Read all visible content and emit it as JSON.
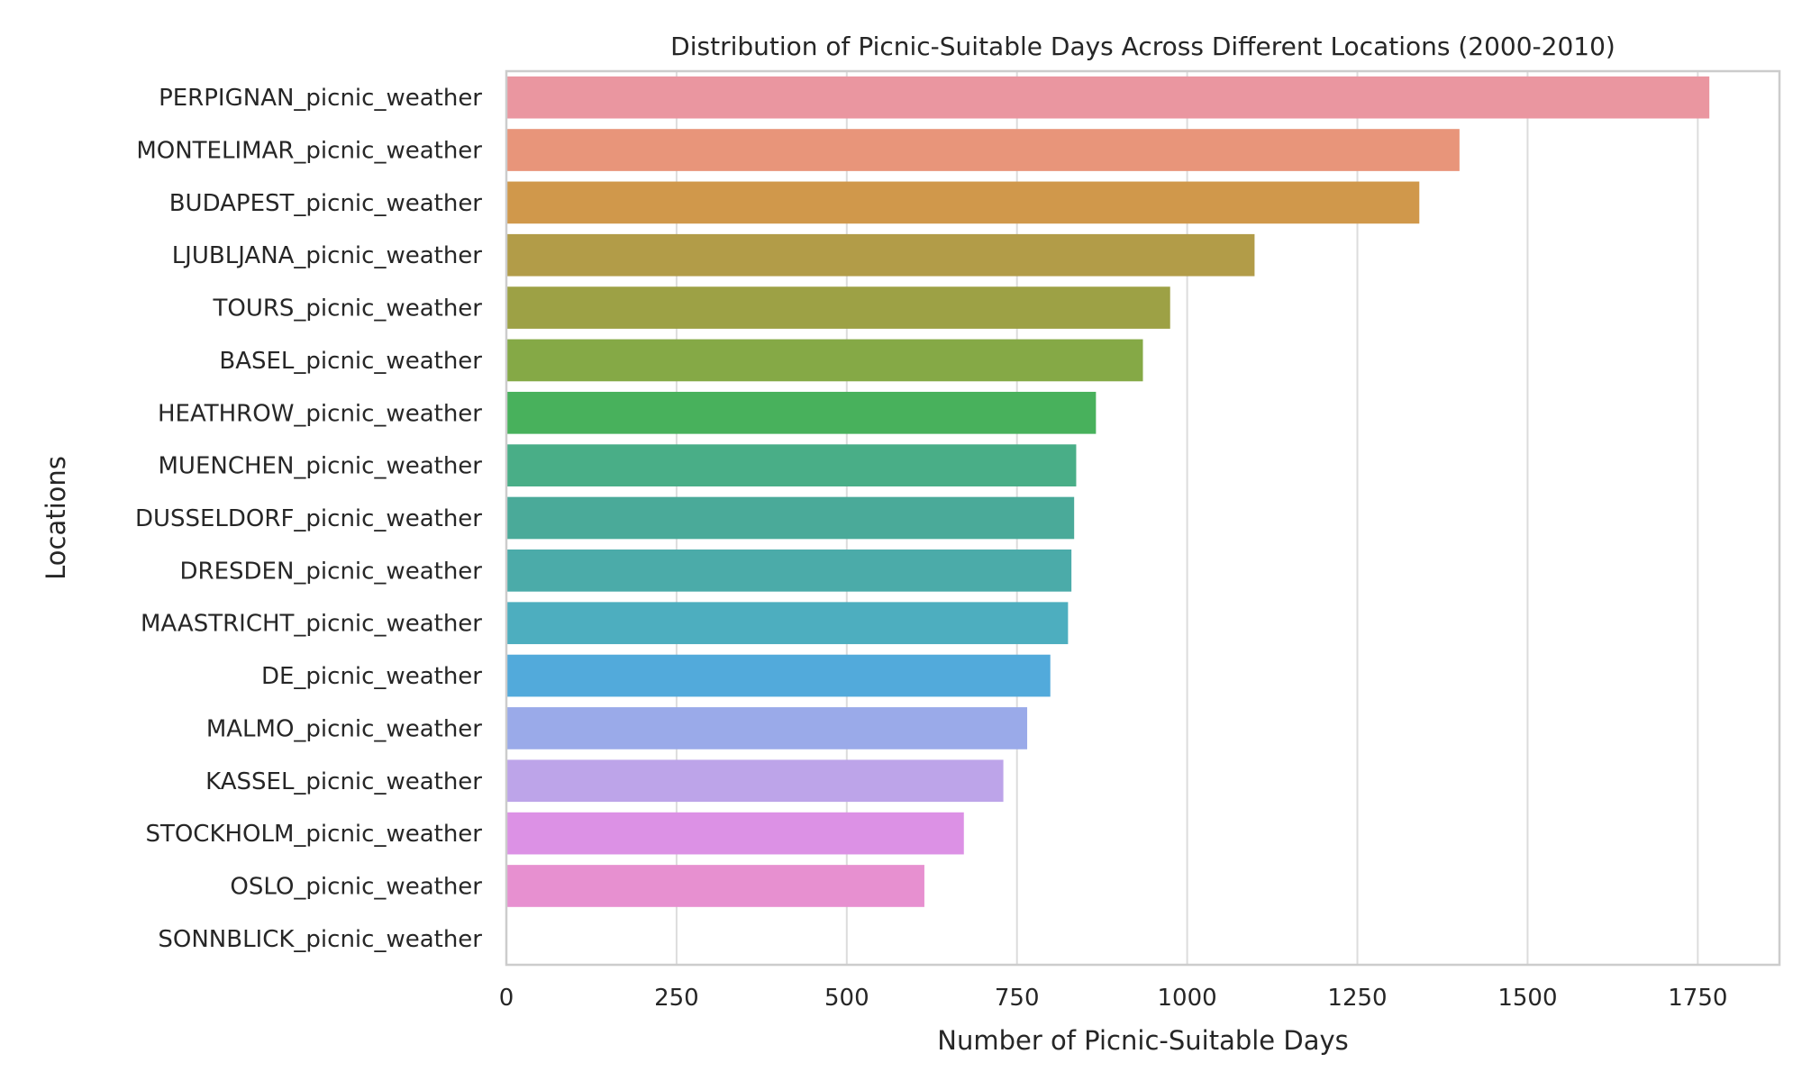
{
  "chart_data": {
    "type": "bar",
    "orientation": "horizontal",
    "title": "Distribution of Picnic-Suitable Days Across Different Locations (2000-2010)",
    "xlabel": "Number of Picnic-Suitable Days",
    "ylabel": "Locations",
    "xlim": [
      0,
      1870
    ],
    "xticks": [
      0,
      250,
      500,
      750,
      1000,
      1250,
      1500,
      1750
    ],
    "xtick_labels": [
      "0",
      "250",
      "500",
      "750",
      "1000",
      "1250",
      "1500",
      "1750"
    ],
    "grid": true,
    "categories": [
      "PERPIGNAN_picnic_weather",
      "MONTELIMAR_picnic_weather",
      "BUDAPEST_picnic_weather",
      "LJUBLJANA_picnic_weather",
      "TOURS_picnic_weather",
      "BASEL_picnic_weather",
      "HEATHROW_picnic_weather",
      "MUENCHEN_picnic_weather",
      "DUSSELDORF_picnic_weather",
      "DRESDEN_picnic_weather",
      "MAASTRICHT_picnic_weather",
      "DE_picnic_weather",
      "MALMO_picnic_weather",
      "KASSEL_picnic_weather",
      "STOCKHOLM_picnic_weather",
      "OSLO_picnic_weather",
      "SONNBLICK_picnic_weather"
    ],
    "values": [
      1767,
      1400,
      1341,
      1099,
      975,
      935,
      866,
      837,
      834,
      830,
      825,
      799,
      765,
      730,
      672,
      614,
      0
    ],
    "colors": [
      "#ea96a0",
      "#e8957a",
      "#d0984b",
      "#b29c48",
      "#9da145",
      "#85a946",
      "#48b15c",
      "#49ae87",
      "#4aaa99",
      "#4baba9",
      "#4daebf",
      "#52aadb",
      "#9aaae9",
      "#bda4e9",
      "#dc91e5",
      "#e790d0",
      "#e68fb8"
    ]
  }
}
